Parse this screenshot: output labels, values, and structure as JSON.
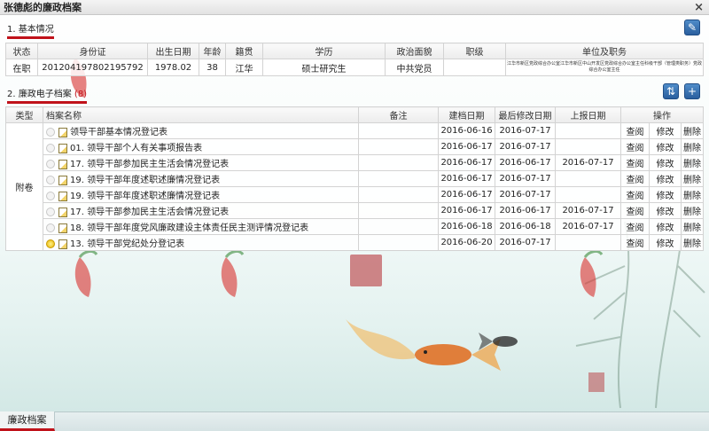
{
  "window": {
    "title": "张德彪的廉政档案",
    "close_label": "×"
  },
  "basic": {
    "title": "1. 基本情况",
    "headers": [
      "状态",
      "身份证",
      "出生日期",
      "年龄",
      "籍贯",
      "学历",
      "政治面貌",
      "职级",
      "单位及职务"
    ],
    "row": [
      "在职",
      "201204197802195792",
      "1978.02",
      "38",
      "江华",
      "硕士研究生",
      "中共党员",
      "",
      "江华市新区党政综合办公室江华市新区中山开发区党政综合办公室主任科级干部（管理类职务）党政综合办公室主任"
    ]
  },
  "archive": {
    "title": "2. 廉政电子档案",
    "count": "(8)",
    "headers": [
      "类型",
      "档案名称",
      "备注",
      "建档日期",
      "最后修改日期",
      "上报日期",
      "操作"
    ],
    "type_label": "附卷",
    "actions": {
      "view": "查阅",
      "edit": "修改",
      "delete": "删除"
    },
    "rows": [
      {
        "name": "领导干部基本情况登记表",
        "remark": "",
        "created": "2016-06-16",
        "modified": "2016-07-17",
        "reported": "",
        "selected": false
      },
      {
        "name": "01. 领导干部个人有关事项报告表",
        "remark": "",
        "created": "2016-06-17",
        "modified": "2016-07-17",
        "reported": "",
        "selected": false
      },
      {
        "name": "17. 领导干部参加民主生活会情况登记表",
        "remark": "",
        "created": "2016-06-17",
        "modified": "2016-06-17",
        "reported": "2016-07-17",
        "selected": false
      },
      {
        "name": "19. 领导干部年度述职述廉情况登记表",
        "remark": "",
        "created": "2016-06-17",
        "modified": "2016-07-17",
        "reported": "",
        "selected": false
      },
      {
        "name": "19. 领导干部年度述职述廉情况登记表",
        "remark": "",
        "created": "2016-06-17",
        "modified": "2016-07-17",
        "reported": "",
        "selected": false
      },
      {
        "name": "17. 领导干部参加民主生活会情况登记表",
        "remark": "",
        "created": "2016-06-17",
        "modified": "2016-06-17",
        "reported": "2016-07-17",
        "selected": false
      },
      {
        "name": "18. 领导干部年度党风廉政建设主体责任民主测评情况登记表",
        "remark": "",
        "created": "2016-06-18",
        "modified": "2016-06-18",
        "reported": "2016-07-17",
        "selected": false
      },
      {
        "name": "13. 领导干部党纪处分登记表",
        "remark": "",
        "created": "2016-06-20",
        "modified": "2016-07-17",
        "reported": "",
        "selected": true
      }
    ]
  },
  "bottom_tab": "廉政档案",
  "icons": [
    "close-icon",
    "edit-icon",
    "sort-icon",
    "add-icon",
    "radio-icon",
    "document-icon"
  ],
  "colors": {
    "accent": "#c0121a",
    "button_blue": "#2a5f9e"
  }
}
